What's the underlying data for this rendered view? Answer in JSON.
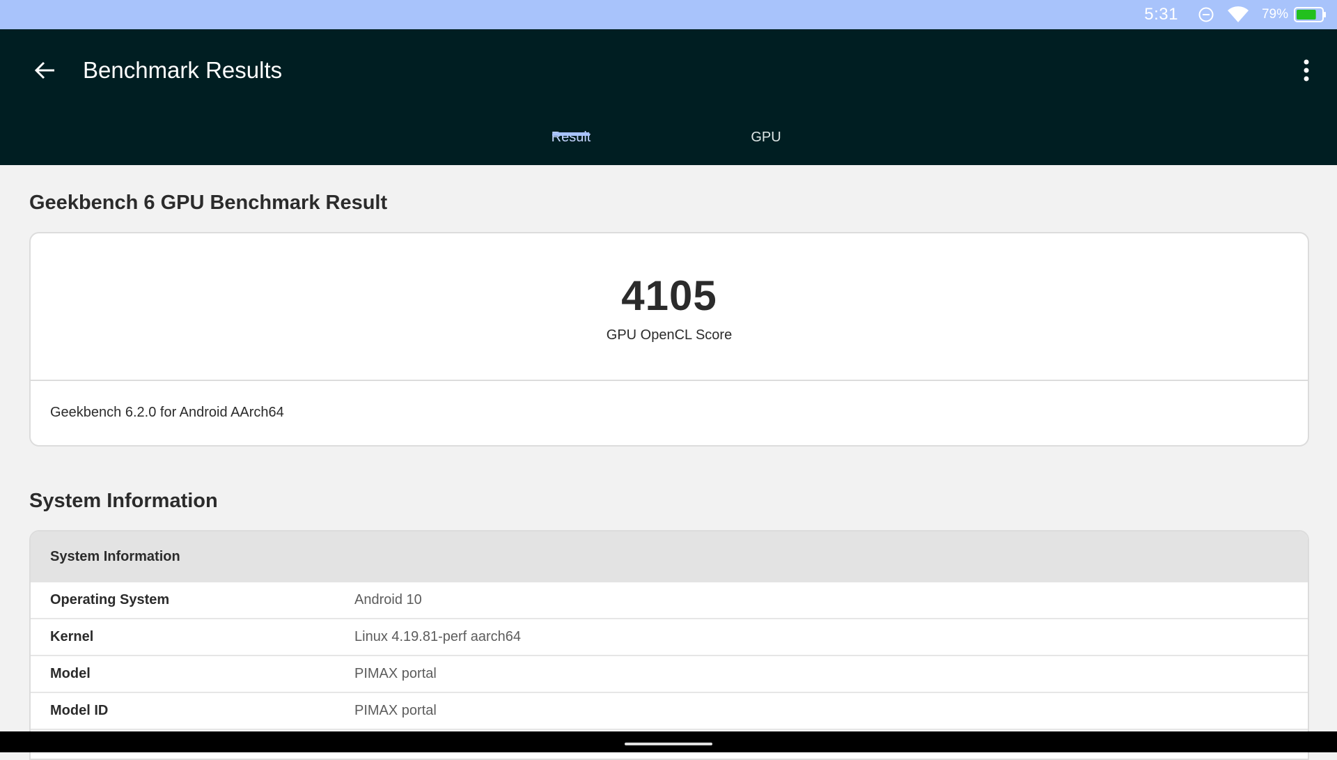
{
  "status_bar": {
    "time": "5:31",
    "battery_percent": "79%",
    "battery_level": 0.79,
    "icons": [
      "do-not-disturb-icon",
      "wifi-icon",
      "battery-icon"
    ]
  },
  "app_bar": {
    "title": "Benchmark Results",
    "back_icon": "arrow-back-icon",
    "overflow_icon": "more-vert-icon",
    "background_color": "#001e22"
  },
  "tabs": [
    {
      "label": "Result",
      "active": true
    },
    {
      "label": "GPU",
      "active": false
    }
  ],
  "result_section": {
    "heading": "Geekbench 6 GPU Benchmark Result",
    "score": "4105",
    "score_label": "GPU OpenCL Score",
    "version": "Geekbench 6.2.0 for Android AArch64"
  },
  "system_section": {
    "heading": "System Information",
    "table_header": "System Information",
    "rows": [
      {
        "key": "Operating System",
        "value": "Android 10"
      },
      {
        "key": "Kernel",
        "value": "Linux 4.19.81-perf aarch64"
      },
      {
        "key": "Model",
        "value": "PIMAX portal"
      },
      {
        "key": "Model ID",
        "value": "PIMAX portal"
      }
    ]
  },
  "colors": {
    "status_bar": "#a8c3fb",
    "accent": "#a8c3fb",
    "battery_fill": "#22c01e"
  }
}
